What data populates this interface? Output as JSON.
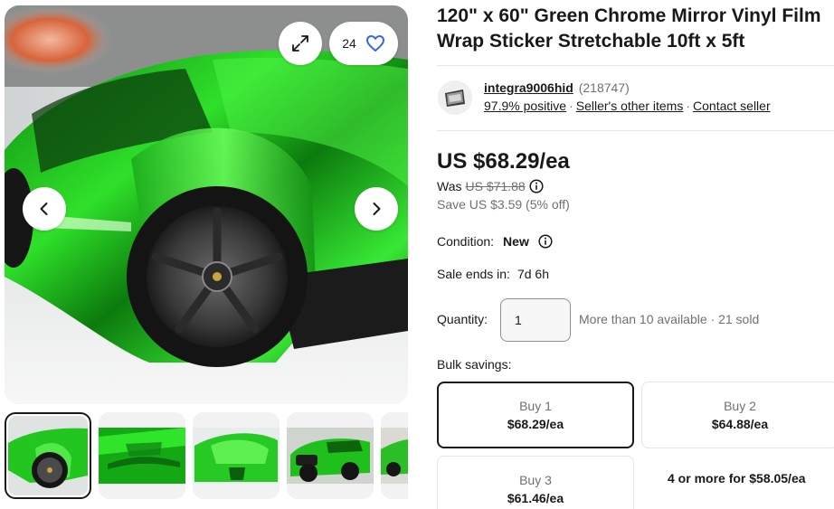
{
  "gallery": {
    "watch_count": "24",
    "thumb_count": 5,
    "selected_thumb": 1
  },
  "listing": {
    "title": "120\" x 60\" Green Chrome Mirror Vinyl Film Wrap Sticker Stretchable 10ft x 5ft"
  },
  "seller": {
    "name": "integra9006hid",
    "score": "(218747)",
    "positive": "97.9% positive",
    "other_items": "Seller's other items",
    "contact": "Contact seller",
    "separator": "·"
  },
  "pricing": {
    "price": "US $68.29/ea",
    "was_label": "Was",
    "was_price": "US $71.88",
    "save": "Save US $3.59 (5% off)"
  },
  "condition": {
    "label": "Condition:",
    "value": "New"
  },
  "sale": {
    "label": "Sale ends in:",
    "value": "7d 6h"
  },
  "quantity": {
    "label": "Quantity:",
    "value": "1",
    "availability": "More than 10 available · 21 sold"
  },
  "bulk": {
    "label": "Bulk savings:",
    "options": [
      {
        "tier": "Buy 1",
        "price": "$68.29/ea",
        "selected": true
      },
      {
        "tier": "Buy 2",
        "price": "$64.88/ea",
        "selected": false
      },
      {
        "tier": "Buy 3",
        "price": "$61.46/ea",
        "selected": false
      }
    ],
    "more": "4 or more for $58.05/ea"
  },
  "colors": {
    "text": "#191919",
    "muted": "#707070",
    "watch_heart": "#3665f3",
    "car_green": "#1fc41f"
  }
}
